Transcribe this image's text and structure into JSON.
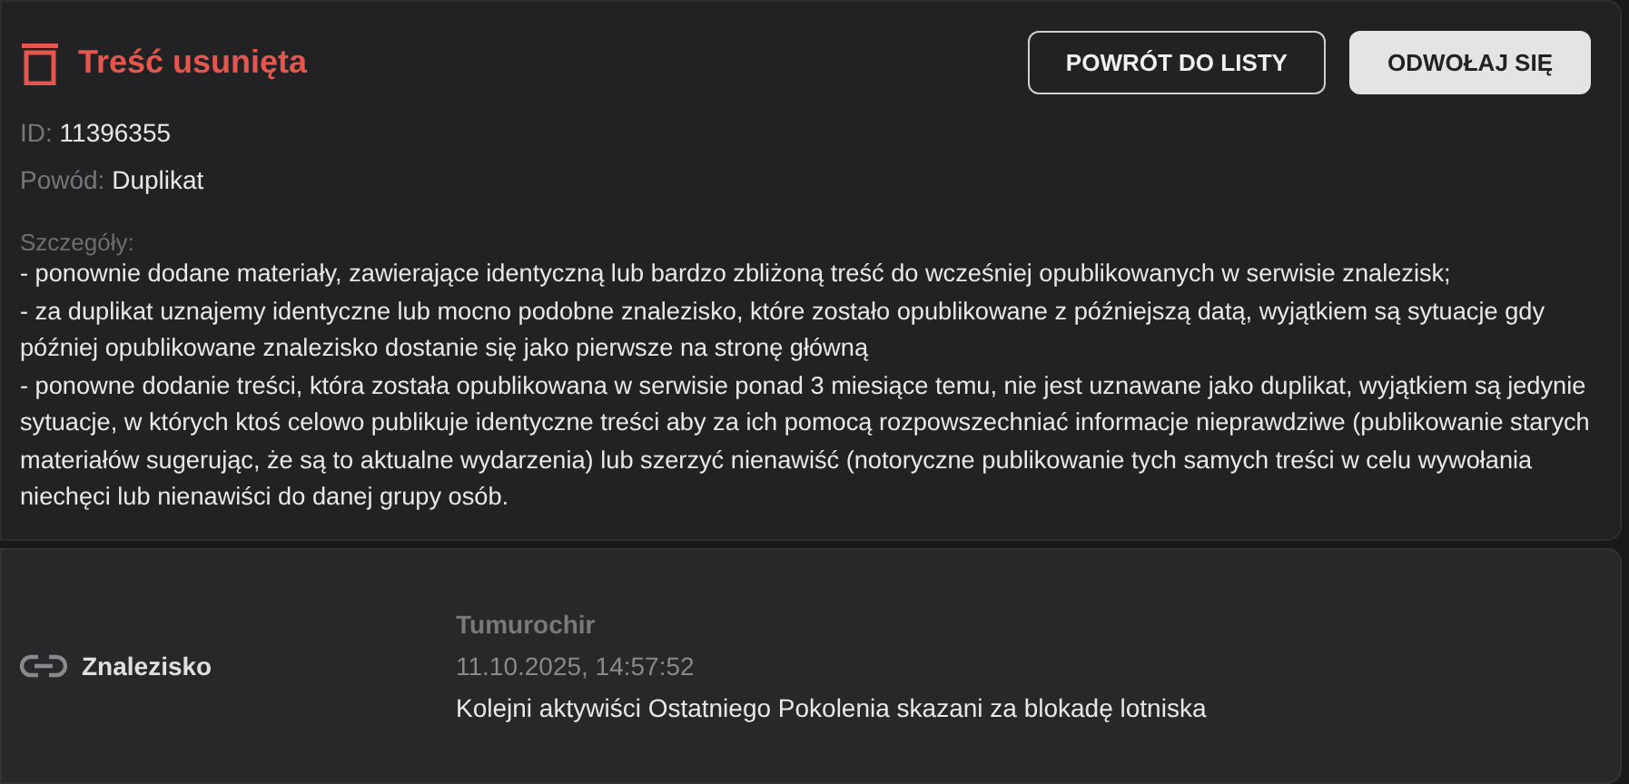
{
  "header": {
    "title": "Treść usunięta",
    "buttons": [
      {
        "label": "POWRÓT DO LISTY",
        "kind": "outline"
      },
      {
        "label": "ODWOŁAJ SIĘ",
        "kind": "filled"
      }
    ]
  },
  "fields": [
    {
      "label": "ID:",
      "value": "11396355"
    },
    {
      "label": "Powód:",
      "value": "Duplikat"
    }
  ],
  "details": {
    "label": "Szczegóły:",
    "lines": [
      "- ponownie dodane materiały, zawierające identyczną lub bardzo zbliżoną treść do wcześniej opublikowanych w serwisie znalezisk;",
      "- za duplikat uznajemy identyczne lub mocno podobne znalezisko, które zostało opublikowane z późniejszą datą, wyjątkiem są sytuacje gdy później opublikowane znalezisko dostanie się jako pierwsze na stronę główną",
      "- ponowne dodanie treści, która została opublikowana w serwisie ponad 3 miesiące temu, nie jest uznawane jako duplikat, wyjątkiem są jedynie sytuacje, w których ktoś celowo publikuje identyczne treści aby za ich pomocą rozpowszechniać informacje nieprawdziwe (publikowanie starych materiałów sugerując, że są to aktualne wydarzenia) lub szerzyć nienawiść (notoryczne publikowanie tych samych treści w celu wywołania niechęci lub nienawiści do danej grupy osób."
    ]
  },
  "item": {
    "type": "Znalezisko",
    "author": "Tumurochir",
    "date": "11.10.2025, 14:57:52",
    "title": "Kolejni aktywiści Ostatniego Pokolenia skazani za blokadę lotniska"
  }
}
